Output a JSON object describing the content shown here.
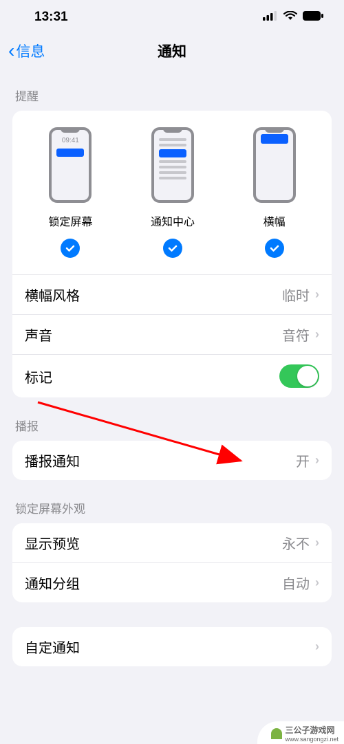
{
  "status_bar": {
    "time": "13:31"
  },
  "nav": {
    "back": "信息",
    "title": "通知"
  },
  "sections": {
    "alerts_header": "提醒",
    "announce_header": "播报",
    "lockscreen_header": "锁定屏幕外观"
  },
  "alerts": {
    "lock_screen": {
      "label": "锁定屏幕",
      "time": "09:41"
    },
    "notification_center": {
      "label": "通知中心"
    },
    "banners": {
      "label": "横幅"
    }
  },
  "rows": {
    "banner_style": {
      "label": "横幅风格",
      "value": "临时"
    },
    "sound": {
      "label": "声音",
      "value": "音符"
    },
    "badge": {
      "label": "标记"
    },
    "announce": {
      "label": "播报通知",
      "value": "开"
    },
    "preview": {
      "label": "显示预览",
      "value": "永不"
    },
    "grouping": {
      "label": "通知分组",
      "value": "自动"
    },
    "customize": {
      "label": "自定通知"
    }
  },
  "watermark": {
    "text": "三公子游戏网",
    "url": "www.sangongzi.net"
  }
}
